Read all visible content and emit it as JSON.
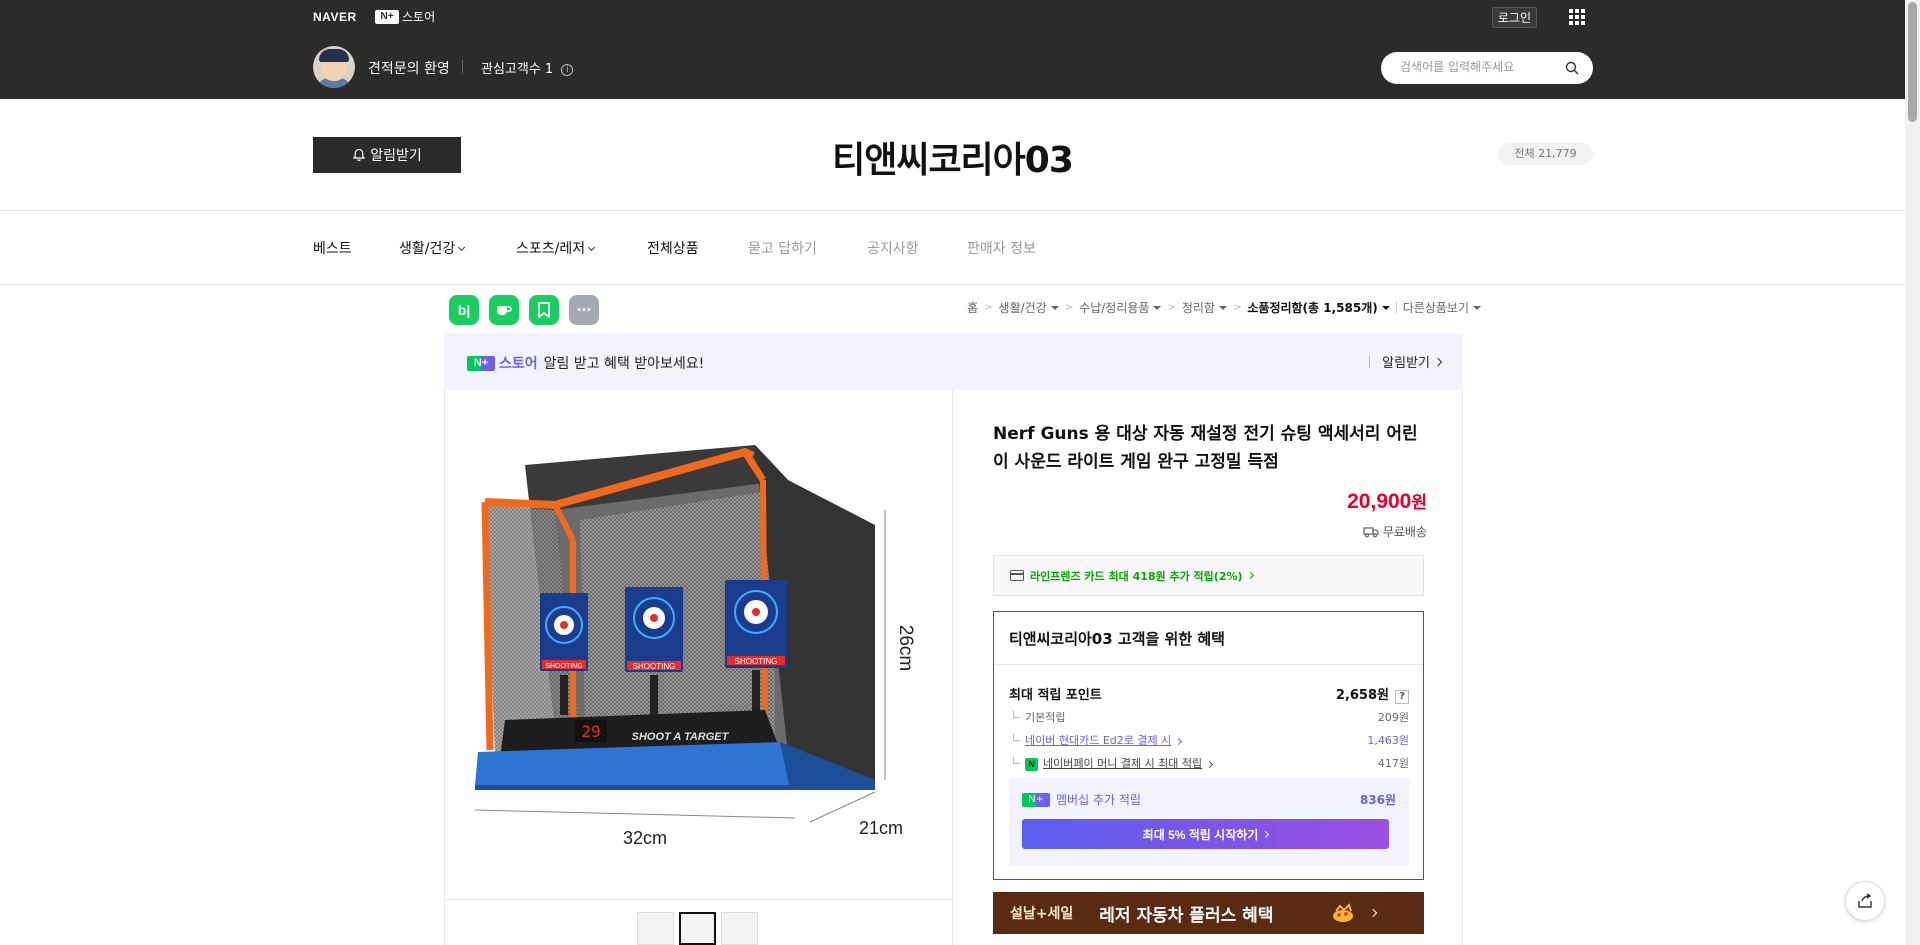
{
  "topbar": {
    "naver_logo": "NAVER",
    "nplus_mark": "N+",
    "store_label": "스토어",
    "login_label": "로그인",
    "owner_greeting": "견적문의 환영",
    "fans_label": "관심고객수 1",
    "search_placeholder": "검색어를 입력해주세요"
  },
  "store": {
    "notify_label": "알림받기",
    "title": "티앤씨코리아03",
    "total_label": "전체 21,779"
  },
  "catnav": {
    "items": [
      {
        "label": "베스트",
        "dropdown": false,
        "dim": false
      },
      {
        "label": "생활/건강",
        "dropdown": true,
        "dim": false
      },
      {
        "label": "스포츠/레저",
        "dropdown": true,
        "dim": false
      },
      {
        "label": "전체상품",
        "dropdown": false,
        "dim": false
      },
      {
        "label": "묻고 답하기",
        "dropdown": false,
        "dim": true
      },
      {
        "label": "공지사항",
        "dropdown": false,
        "dim": true
      },
      {
        "label": "판매자 정보",
        "dropdown": false,
        "dim": true
      }
    ]
  },
  "share": {
    "blog": "b|",
    "more": "···"
  },
  "breadcrumb": {
    "items": [
      "홈",
      "생활/건강",
      "수납/정리용품",
      "정리함",
      "소품정리함(총 1,585개)"
    ],
    "other": "다른상품보기"
  },
  "promo": {
    "nplus": "N+",
    "store": "스토어",
    "message": "알림 받고 혜택 받아보세요!",
    "action": "알림받기"
  },
  "product": {
    "title": "Nerf Guns 용 대상 자동 재설정 전기 슈팅 액세서리 어린이 사운드 라이트 게임 완구 고정밀 득점",
    "price": "20,900",
    "price_unit": "원",
    "shipping": "무료배송",
    "card_benefit": "라인프렌즈 카드 최대 418원 추가 적립(2%)",
    "image_labels": {
      "height": "26cm",
      "width": "32cm",
      "depth": "21cm",
      "brand": "SHOOT A TARGET",
      "counter": "29",
      "target": "SHOOTING"
    }
  },
  "benefit": {
    "title": "티앤씨코리아03 고객을 위한 혜택",
    "max_points_label": "최대 적립 포인트",
    "max_points_value": "2,658원",
    "q_mark": "?",
    "rows": [
      {
        "label": "기본적립",
        "value": "209원"
      },
      {
        "label": "네이버 현대카드 Ed2로 결제 시",
        "value": "1,463원"
      },
      {
        "label": "네이버페이 머니 결제 시 최대 적립",
        "value": "417원"
      }
    ],
    "npay_mark": "N",
    "membership": {
      "nplus": "N+",
      "label": "멤버십 추가 적립",
      "value": "836원",
      "button": "최대 5% 적립 시작하기"
    }
  },
  "event": {
    "tag": "설날+세일",
    "text": "레저 자동차 플러스 혜택"
  },
  "colors": {
    "topbar": "#2b2b2b",
    "price": "#e4002b",
    "naver_green": "#03c75a",
    "membership_purple": "#6e5ff0",
    "event_bg": "#5a2a13"
  }
}
